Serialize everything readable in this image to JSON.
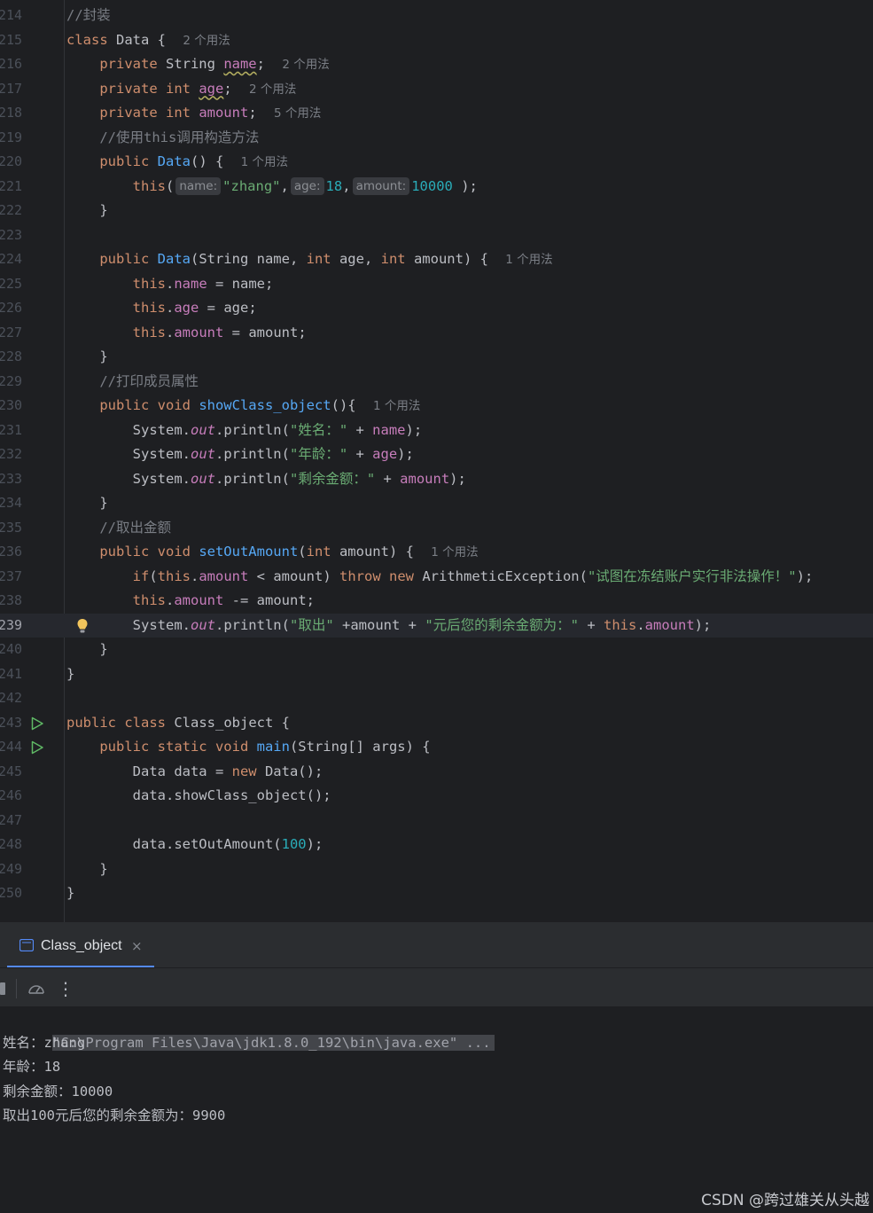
{
  "editor": {
    "lines": [
      {
        "num": "214",
        "segs": [
          {
            "t": "//封装",
            "c": "cm"
          }
        ]
      },
      {
        "num": "215",
        "segs": [
          {
            "t": "class ",
            "c": "k"
          },
          {
            "t": "Data { "
          },
          {
            "t": "2 个用法",
            "c": "hint"
          }
        ]
      },
      {
        "num": "216",
        "segs": [
          {
            "t": "    "
          },
          {
            "t": "private ",
            "c": "k"
          },
          {
            "t": "String "
          },
          {
            "t": "name",
            "c": "fld uline"
          },
          {
            "t": "; "
          },
          {
            "t": "2 个用法",
            "c": "hint"
          }
        ]
      },
      {
        "num": "217",
        "segs": [
          {
            "t": "    "
          },
          {
            "t": "private int ",
            "c": "k"
          },
          {
            "t": "age",
            "c": "fld uline"
          },
          {
            "t": "; "
          },
          {
            "t": "2 个用法",
            "c": "hint"
          }
        ]
      },
      {
        "num": "218",
        "segs": [
          {
            "t": "    "
          },
          {
            "t": "private int ",
            "c": "k"
          },
          {
            "t": "amount",
            "c": "fld"
          },
          {
            "t": "; "
          },
          {
            "t": "5 个用法",
            "c": "hint"
          }
        ]
      },
      {
        "num": "219",
        "segs": [
          {
            "t": "    "
          },
          {
            "t": "//使用this调用构造方法",
            "c": "cm"
          }
        ]
      },
      {
        "num": "220",
        "segs": [
          {
            "t": "    "
          },
          {
            "t": "public ",
            "c": "k"
          },
          {
            "t": "Data",
            "c": "fn"
          },
          {
            "t": "() { "
          },
          {
            "t": "1 个用法",
            "c": "hint"
          }
        ]
      },
      {
        "num": "221",
        "segs": [
          {
            "t": "        "
          },
          {
            "t": "this",
            "c": "k"
          },
          {
            "t": "("
          },
          {
            "t": "name:",
            "c": "phint"
          },
          {
            "t": "\"zhang\"",
            "c": "str"
          },
          {
            "t": ","
          },
          {
            "t": "age:",
            "c": "phint"
          },
          {
            "t": "18",
            "c": "num"
          },
          {
            "t": ","
          },
          {
            "t": "amount:",
            "c": "phint"
          },
          {
            "t": "10000",
            "c": "num"
          },
          {
            "t": " );"
          }
        ]
      },
      {
        "num": "222",
        "segs": [
          {
            "t": "    }"
          }
        ]
      },
      {
        "num": "223",
        "segs": []
      },
      {
        "num": "224",
        "segs": [
          {
            "t": "    "
          },
          {
            "t": "public ",
            "c": "k"
          },
          {
            "t": "Data",
            "c": "fn"
          },
          {
            "t": "(String name, "
          },
          {
            "t": "int ",
            "c": "k"
          },
          {
            "t": "age, "
          },
          {
            "t": "int ",
            "c": "k"
          },
          {
            "t": "amount) { "
          },
          {
            "t": "1 个用法",
            "c": "hint"
          }
        ]
      },
      {
        "num": "225",
        "segs": [
          {
            "t": "        "
          },
          {
            "t": "this",
            "c": "k"
          },
          {
            "t": "."
          },
          {
            "t": "name",
            "c": "fld"
          },
          {
            "t": " = name;"
          }
        ]
      },
      {
        "num": "226",
        "segs": [
          {
            "t": "        "
          },
          {
            "t": "this",
            "c": "k"
          },
          {
            "t": "."
          },
          {
            "t": "age",
            "c": "fld"
          },
          {
            "t": " = age;"
          }
        ]
      },
      {
        "num": "227",
        "segs": [
          {
            "t": "        "
          },
          {
            "t": "this",
            "c": "k"
          },
          {
            "t": "."
          },
          {
            "t": "amount",
            "c": "fld"
          },
          {
            "t": " = amount;"
          }
        ]
      },
      {
        "num": "228",
        "segs": [
          {
            "t": "    }"
          }
        ]
      },
      {
        "num": "229",
        "segs": [
          {
            "t": "    "
          },
          {
            "t": "//打印成员属性",
            "c": "cm"
          }
        ]
      },
      {
        "num": "230",
        "segs": [
          {
            "t": "    "
          },
          {
            "t": "public void ",
            "c": "k"
          },
          {
            "t": "showClass_object",
            "c": "fn"
          },
          {
            "t": "(){ "
          },
          {
            "t": "1 个用法",
            "c": "hint"
          }
        ]
      },
      {
        "num": "231",
        "segs": [
          {
            "t": "        System."
          },
          {
            "t": "out",
            "c": "st"
          },
          {
            "t": ".println("
          },
          {
            "t": "\"姓名：\"",
            "c": "str"
          },
          {
            "t": " + "
          },
          {
            "t": "name",
            "c": "fld"
          },
          {
            "t": ");"
          }
        ]
      },
      {
        "num": "232",
        "segs": [
          {
            "t": "        System."
          },
          {
            "t": "out",
            "c": "st"
          },
          {
            "t": ".println("
          },
          {
            "t": "\"年龄：\"",
            "c": "str"
          },
          {
            "t": " + "
          },
          {
            "t": "age",
            "c": "fld"
          },
          {
            "t": ");"
          }
        ]
      },
      {
        "num": "233",
        "segs": [
          {
            "t": "        System."
          },
          {
            "t": "out",
            "c": "st"
          },
          {
            "t": ".println("
          },
          {
            "t": "\"剩余金额：\"",
            "c": "str"
          },
          {
            "t": " + "
          },
          {
            "t": "amount",
            "c": "fld"
          },
          {
            "t": ");"
          }
        ]
      },
      {
        "num": "234",
        "segs": [
          {
            "t": "    }"
          }
        ]
      },
      {
        "num": "235",
        "segs": [
          {
            "t": "    "
          },
          {
            "t": "//取出金额",
            "c": "cm"
          }
        ]
      },
      {
        "num": "236",
        "segs": [
          {
            "t": "    "
          },
          {
            "t": "public void ",
            "c": "k"
          },
          {
            "t": "setOutAmount",
            "c": "fn"
          },
          {
            "t": "("
          },
          {
            "t": "int ",
            "c": "k"
          },
          {
            "t": "amount) { "
          },
          {
            "t": "1 个用法",
            "c": "hint"
          }
        ]
      },
      {
        "num": "237",
        "segs": [
          {
            "t": "        "
          },
          {
            "t": "if",
            "c": "k"
          },
          {
            "t": "("
          },
          {
            "t": "this",
            "c": "k"
          },
          {
            "t": "."
          },
          {
            "t": "amount",
            "c": "fld"
          },
          {
            "t": " < amount) "
          },
          {
            "t": "throw new ",
            "c": "k"
          },
          {
            "t": "ArithmeticException("
          },
          {
            "t": "\"试图在冻结账户实行非法操作！\"",
            "c": "str"
          },
          {
            "t": ");"
          }
        ]
      },
      {
        "num": "238",
        "segs": [
          {
            "t": "        "
          },
          {
            "t": "this",
            "c": "k"
          },
          {
            "t": "."
          },
          {
            "t": "amount",
            "c": "fld"
          },
          {
            "t": " -= amount;"
          }
        ]
      },
      {
        "num": "239",
        "segs": [
          {
            "t": "        System."
          },
          {
            "t": "out",
            "c": "st"
          },
          {
            "t": ".println("
          },
          {
            "t": "\"取出\"",
            "c": "str"
          },
          {
            "t": " +amount + "
          },
          {
            "t": "\"元后您的剩余金额为：\"",
            "c": "str"
          },
          {
            "t": " + "
          },
          {
            "t": "this",
            "c": "k"
          },
          {
            "t": "."
          },
          {
            "t": "amount",
            "c": "fld"
          },
          {
            "t": ");"
          }
        ]
      },
      {
        "num": "240",
        "segs": [
          {
            "t": "    }"
          }
        ]
      },
      {
        "num": "241",
        "segs": [
          {
            "t": "}"
          }
        ]
      },
      {
        "num": "242",
        "segs": []
      },
      {
        "num": "243",
        "segs": [
          {
            "t": "public class ",
            "c": "k"
          },
          {
            "t": "Class_object {"
          }
        ]
      },
      {
        "num": "244",
        "segs": [
          {
            "t": "    "
          },
          {
            "t": "public static void ",
            "c": "k"
          },
          {
            "t": "main",
            "c": "fn"
          },
          {
            "t": "(String[] args) {"
          }
        ]
      },
      {
        "num": "245",
        "segs": [
          {
            "t": "        Data data = "
          },
          {
            "t": "new ",
            "c": "k"
          },
          {
            "t": "Data();"
          }
        ]
      },
      {
        "num": "246",
        "segs": [
          {
            "t": "        data.showClass_object();"
          }
        ]
      },
      {
        "num": "247",
        "segs": []
      },
      {
        "num": "248",
        "segs": [
          {
            "t": "        data.setOutAmount("
          },
          {
            "t": "100",
            "c": "num"
          },
          {
            "t": ");"
          }
        ]
      },
      {
        "num": "249",
        "segs": [
          {
            "t": "    }"
          }
        ]
      },
      {
        "num": "250",
        "segs": [
          {
            "t": "}"
          }
        ]
      }
    ],
    "current_line": "239",
    "run_lines": [
      "243",
      "244"
    ],
    "bulb_line": "239"
  },
  "run_panel": {
    "tab_label": "Class_object",
    "tab_close": "×",
    "more_glyph": "⋮"
  },
  "console": {
    "command": "\"C:\\Program Files\\Java\\jdk1.8.0_192\\bin\\java.exe\" ...",
    "output": [
      "姓名：zhang",
      "年龄：18",
      "剩余金额：10000",
      "取出100元后您的剩余金额为：9900"
    ]
  },
  "watermark": "CSDN @跨过雄关从头越",
  "colors": {
    "background": "#1e1f22",
    "keyword": "#cf8e6d",
    "function": "#56a8f5",
    "field": "#c77dbb",
    "string": "#6aab73",
    "number": "#2aacb8",
    "comment": "#7a7e85",
    "run_green": "#5fb865",
    "bulb_yellow": "#f2c55c"
  }
}
